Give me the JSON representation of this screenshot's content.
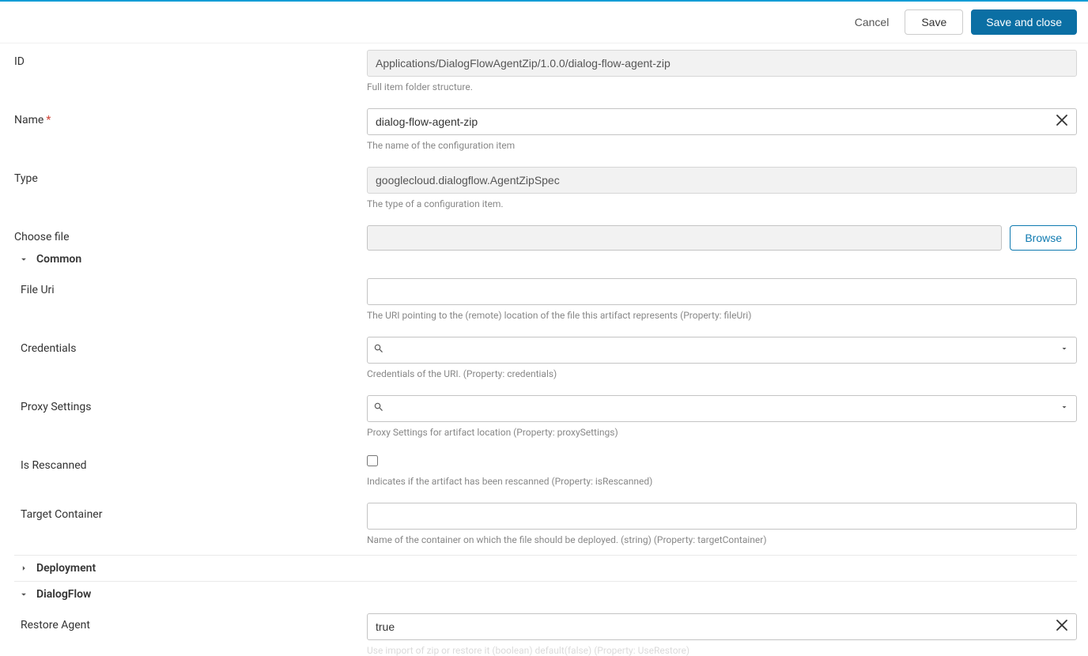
{
  "header": {
    "cancel": "Cancel",
    "save": "Save",
    "save_close": "Save and close"
  },
  "fields": {
    "id": {
      "label": "ID",
      "value": "Applications/DialogFlowAgentZip/1.0.0/dialog-flow-agent-zip",
      "help": "Full item folder structure."
    },
    "name": {
      "label": "Name",
      "value": "dialog-flow-agent-zip",
      "help": "The name of the configuration item"
    },
    "type": {
      "label": "Type",
      "value": "googlecloud.dialogflow.AgentZipSpec",
      "help": "The type of a configuration item."
    },
    "choose_file": {
      "label": "Choose file",
      "browse": "Browse"
    },
    "file_uri": {
      "label": "File Uri",
      "value": "",
      "help": "The URI pointing to the (remote) location of the file this artifact represents (Property: fileUri)"
    },
    "credentials": {
      "label": "Credentials",
      "value": "",
      "help": "Credentials of the URI. (Property: credentials)"
    },
    "proxy_settings": {
      "label": "Proxy Settings",
      "value": "",
      "help": "Proxy Settings for artifact location (Property: proxySettings)"
    },
    "is_rescanned": {
      "label": "Is Rescanned",
      "checked": false,
      "help": "Indicates if the artifact has been rescanned (Property: isRescanned)"
    },
    "target_container": {
      "label": "Target Container",
      "value": "",
      "help": "Name of the container on which the file should be deployed. (string) (Property: targetContainer)"
    },
    "restore_agent": {
      "label": "Restore Agent",
      "value": "true",
      "help": "Use import of zip or restore it (boolean) default(false) (Property: UseRestore)"
    }
  },
  "sections": {
    "common": "Common",
    "deployment": "Deployment",
    "dialogflow": "DialogFlow"
  }
}
